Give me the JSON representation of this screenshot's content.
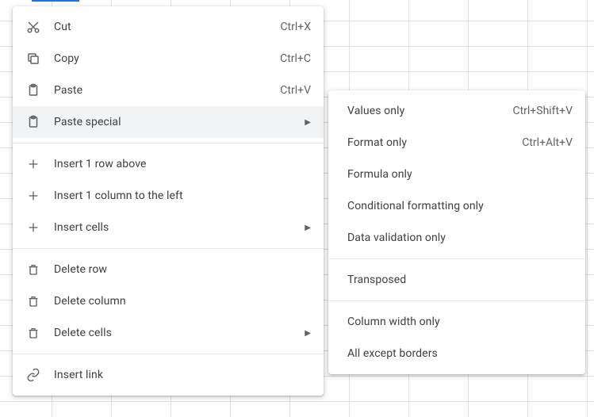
{
  "main_menu": {
    "cut": {
      "label": "Cut",
      "shortcut": "Ctrl+X"
    },
    "copy": {
      "label": "Copy",
      "shortcut": "Ctrl+C"
    },
    "paste": {
      "label": "Paste",
      "shortcut": "Ctrl+V"
    },
    "paste_special": {
      "label": "Paste special"
    },
    "insert_row_above": {
      "label": "Insert 1 row above"
    },
    "insert_col_left": {
      "label": "Insert 1 column to the left"
    },
    "insert_cells": {
      "label": "Insert cells"
    },
    "delete_row": {
      "label": "Delete row"
    },
    "delete_column": {
      "label": "Delete column"
    },
    "delete_cells": {
      "label": "Delete cells"
    },
    "insert_link": {
      "label": "Insert link"
    }
  },
  "paste_special_submenu": {
    "values_only": {
      "label": "Values only",
      "shortcut": "Ctrl+Shift+V"
    },
    "format_only": {
      "label": "Format only",
      "shortcut": "Ctrl+Alt+V"
    },
    "formula_only": {
      "label": "Formula only"
    },
    "cond_fmt_only": {
      "label": "Conditional formatting only"
    },
    "data_val_only": {
      "label": "Data validation only"
    },
    "transposed": {
      "label": "Transposed"
    },
    "col_width_only": {
      "label": "Column width only"
    },
    "all_except_borders": {
      "label": "All except borders"
    }
  }
}
